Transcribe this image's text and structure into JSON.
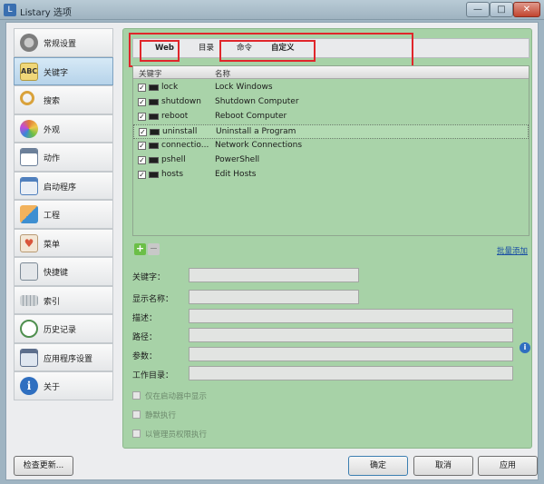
{
  "window": {
    "title": "Listary 选项",
    "minimize": "—",
    "maximize": "□",
    "close": "✕"
  },
  "sidebar": {
    "items": [
      {
        "label": "常规设置",
        "icon": "gear-icon",
        "color": "#8a8a8a"
      },
      {
        "label": "关键字",
        "icon": "abc-icon",
        "color": "#f0d779",
        "text": "ABC"
      },
      {
        "label": "搜索",
        "icon": "magnifier-icon",
        "color": "#d9a23b"
      },
      {
        "label": "外观",
        "icon": "palette-icon",
        "color": "#e07a3a"
      },
      {
        "label": "动作",
        "icon": "action-icon",
        "color": "#6b7f99"
      },
      {
        "label": "启动程序",
        "icon": "launcher-icon",
        "color": "#4f7fbd"
      },
      {
        "label": "工程",
        "icon": "cube-icon",
        "color": "#e0873a"
      },
      {
        "label": "菜单",
        "icon": "menu-heart-icon",
        "color": "#d9553b"
      },
      {
        "label": "快捷键",
        "icon": "hotkey-icon",
        "color": "#7c8a96"
      },
      {
        "label": "索引",
        "icon": "keyboard-icon",
        "color": "#9aa3aa"
      },
      {
        "label": "历史记录",
        "icon": "history-clock-icon",
        "color": "#4f8f4f"
      },
      {
        "label": "应用程序设置",
        "icon": "app-settings-icon",
        "color": "#5c6e8c"
      },
      {
        "label": "关于",
        "icon": "info-circle-icon",
        "color": "#2f6fc0",
        "text": "i"
      }
    ],
    "active_index": 1,
    "check_update": "检查更新..."
  },
  "tabs": [
    "Web",
    "目录",
    "命令",
    "自定义"
  ],
  "keyword_list": {
    "headers": {
      "key": "关键字",
      "name": "名称"
    },
    "rows": [
      {
        "key": "lock",
        "name": "Lock Windows",
        "checked": true
      },
      {
        "key": "shutdown",
        "name": "Shutdown Computer",
        "checked": true
      },
      {
        "key": "reboot",
        "name": "Reboot Computer",
        "checked": true
      },
      {
        "key": "uninstall",
        "name": "Uninstall a Program",
        "checked": true,
        "selected": true
      },
      {
        "key": "connectio...",
        "name": "Network Connections",
        "checked": true
      },
      {
        "key": "pshell",
        "name": "PowerShell",
        "checked": true
      },
      {
        "key": "hosts",
        "name": "Edit Hosts",
        "checked": true
      }
    ],
    "check_mark": "✓"
  },
  "list_actions": {
    "add": "+",
    "remove": "−",
    "batch_add": "批量添加"
  },
  "form": {
    "keyword_label": "关键字：",
    "display_name_label": "显示名称：",
    "description_label": "描述：",
    "path_label": "路径：",
    "params_label": "参数：",
    "workdir_label": "工作目录：",
    "info": "i"
  },
  "options": [
    {
      "label": "仅在启动器中显示"
    },
    {
      "label": "静默执行"
    },
    {
      "label": "以管理员权限执行"
    }
  ],
  "buttons": {
    "ok": "确定",
    "cancel": "取消",
    "apply": "应用"
  },
  "colors": {
    "highlight": "#e0262b",
    "panel": "#a7d2a7",
    "link": "#1a4fa5"
  }
}
